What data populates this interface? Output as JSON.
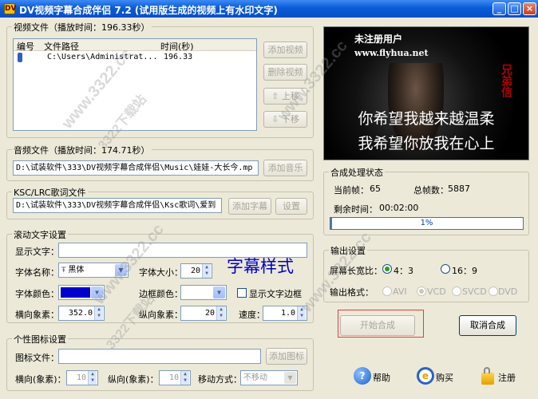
{
  "window": {
    "title": "DV视频字幕合成伴侣 7.2 (试用版生成的视频上有水印文字)",
    "app_icon_glyph": "DV",
    "buttons": [
      "_",
      "□",
      "×"
    ]
  },
  "video_group": {
    "label": "视频文件（播放时间：196.33秒）",
    "columns": [
      "编号",
      "文件路径",
      "时间(秒)"
    ],
    "rows": [
      {
        "path": "C:\\Users\\Administrat...",
        "time": "196.33"
      }
    ],
    "buttons": {
      "add": "添加视频",
      "delete": "删除视频",
      "up": "上移",
      "down": "下移"
    }
  },
  "audio_group": {
    "label": "音频文件（播放时间：174.71秒）",
    "path": "D:\\试装软件\\333\\DV视频字幕合成伴侣\\Music\\娃娃-大长今.mp",
    "button": "添加音乐"
  },
  "lyric_group": {
    "label": "KSC/LRC歌词文件",
    "path": "D:\\试装软件\\333\\DV视频字幕合成伴侣\\Ksc歌词\\爱到",
    "add_button": "添加字幕",
    "settings_button": "设置"
  },
  "scroll_group": {
    "label": "滚动文字设置",
    "text_label": "显示文字：",
    "text_value": "",
    "font_name_label": "字体名称：",
    "font_name_value": "黑体",
    "font_size_label": "字体大小：",
    "font_size_value": "20",
    "preview_text": "字幕样式",
    "font_color_label": "字体颜色：",
    "font_color": "#0000CC",
    "border_color_label": "边框颜色：",
    "border_color": "#FFFFFF",
    "show_border_label": "显示文字边框",
    "h_pixel_label": "横向象素：",
    "h_pixel_value": "352.0",
    "v_pixel_label": "纵向象素：",
    "v_pixel_value": "20",
    "speed_label": "速度：",
    "speed_value": "1.0"
  },
  "logo_group": {
    "label": "个性图标设置",
    "file_label": "图标文件：",
    "file_value": "",
    "add_button": "添加图标",
    "h_label": "横向(象素)：",
    "h_value": "10",
    "v_label": "纵向(象素)：",
    "v_value": "10",
    "move_label": "移动方式：",
    "move_value": "不移动"
  },
  "preview": {
    "watermark_line1": "未注册用户",
    "watermark_line2": "www.flyhua.net",
    "side_text": "兄弟信",
    "lyric_line1": "你希望我越来越温柔",
    "lyric_line2": "我希望你放我在心上"
  },
  "status_group": {
    "label": "合成处理状态",
    "current_frame_label": "当前帧：",
    "current_frame_value": "65",
    "total_frames_label": "总帧数：",
    "total_frames_value": "5887",
    "remaining_label": "剩余时间：",
    "remaining_value": "00:02:00",
    "progress_text": "1%",
    "progress_fraction": 0.01
  },
  "output_group": {
    "label": "输出设置",
    "aspect_label": "屏幕长宽比：",
    "aspect_options": [
      "4：3",
      "16：9"
    ],
    "format_label": "输出格式：",
    "format_options": [
      "AVI",
      "VCD",
      "SVCD",
      "DVD"
    ]
  },
  "actions": {
    "start": "开始合成",
    "cancel": "取消合成",
    "help": "帮助",
    "buy": "购买",
    "register": "注册"
  },
  "watermarks": [
    "www.3322.cc",
    "3322下载站"
  ],
  "colors": {
    "accent": "#0A5BD6",
    "start_highlight": "#E04040"
  }
}
